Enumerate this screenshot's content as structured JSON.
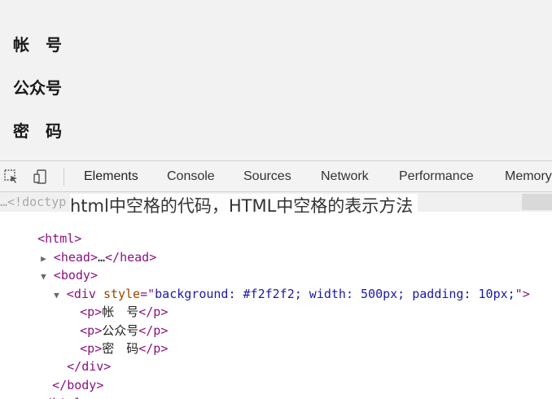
{
  "page": {
    "lines": [
      "帐　号",
      "公众号",
      "密　码"
    ]
  },
  "toolbar": {
    "tabs": [
      "Elements",
      "Console",
      "Sources",
      "Network",
      "Performance",
      "Memory"
    ],
    "active": "Elements"
  },
  "tree": {
    "doctype": "<!doctyp",
    "html_open": "html",
    "head": "head",
    "head_ellipsis": "…",
    "body": "body",
    "div": "div",
    "div_attr": "style",
    "div_style": "background: #f2f2f2; width: 500px; padding: 10px;",
    "p": "p",
    "p_texts": [
      "帐　号",
      "公众号",
      "密　码"
    ]
  },
  "caption": "html中空格的代码，HTML中空格的表示方法"
}
